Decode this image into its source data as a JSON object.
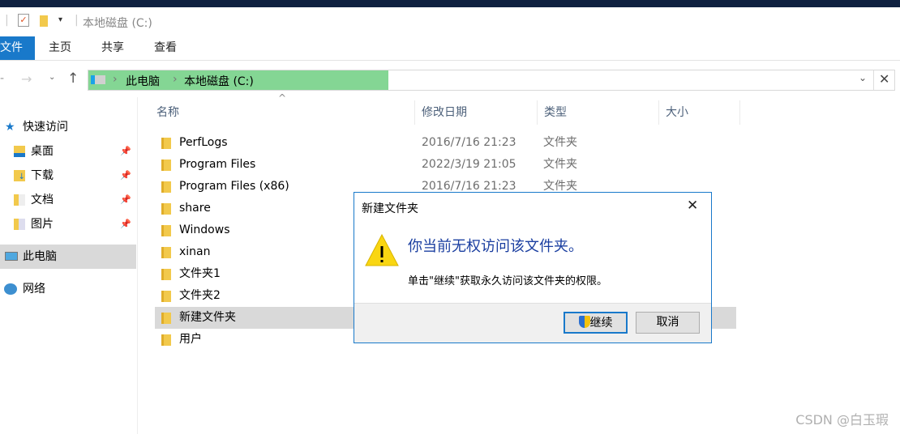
{
  "window": {
    "title": "本地磁盘 (C:)"
  },
  "ribbon": {
    "tabs": [
      "文件",
      "主页",
      "共享",
      "查看"
    ]
  },
  "address": {
    "segments": [
      "此电脑",
      "本地磁盘 (C:)"
    ]
  },
  "sidebar": {
    "quick_access": "快速访问",
    "items": [
      {
        "label": "桌面"
      },
      {
        "label": "下载"
      },
      {
        "label": "文档"
      },
      {
        "label": "图片"
      }
    ],
    "this_pc": "此电脑",
    "network": "网络"
  },
  "columns": [
    "名称",
    "修改日期",
    "类型",
    "大小"
  ],
  "files": [
    {
      "name": "PerfLogs",
      "date": "2016/7/16 21:23",
      "type": "文件夹"
    },
    {
      "name": "Program Files",
      "date": "2022/3/19 21:05",
      "type": "文件夹"
    },
    {
      "name": "Program Files (x86)",
      "date": "2016/7/16 21:23",
      "type": "文件夹"
    },
    {
      "name": "share"
    },
    {
      "name": "Windows"
    },
    {
      "name": "xinan"
    },
    {
      "name": "文件夹1"
    },
    {
      "name": "文件夹2"
    },
    {
      "name": "新建文件夹"
    },
    {
      "name": "用户"
    }
  ],
  "dialog": {
    "title": "新建文件夹",
    "heading": "你当前无权访问该文件夹。",
    "message": "单击\"继续\"获取永久访问该文件夹的权限。",
    "continue": "继续",
    "cancel": "取消"
  },
  "watermark": "CSDN @白玉瑕",
  "colors": {
    "accent": "#1979ca",
    "address_highlight": "#84d694",
    "heading": "#1a3ea0"
  }
}
